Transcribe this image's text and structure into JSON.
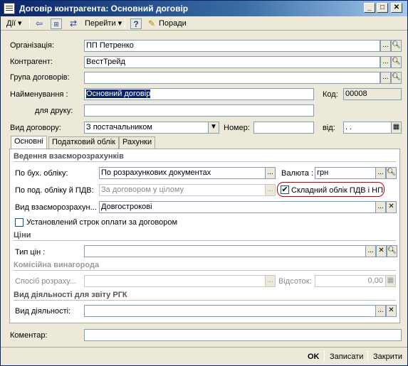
{
  "window": {
    "title": "Договір контрагента: Основний договір"
  },
  "menu": {
    "actions_label": "Дії",
    "goto_label": "Перейти",
    "help_icon_text": "?",
    "hints_label": "Поради"
  },
  "form": {
    "org_label": "Організація:",
    "org_value": "ПП Петренко",
    "counterparty_label": "Контрагент:",
    "counterparty_value": "ВестТрейд",
    "group_label": "Група договорів:",
    "group_value": "",
    "name_label": "Найменування :",
    "name_value": "Основний договір",
    "code_label": "Код:",
    "code_value": "00008",
    "print_label": "для друку:",
    "print_value": "",
    "type_label": "Вид договору:",
    "type_value": "З постачальником",
    "number_label": "Номер:",
    "number_value": "",
    "date_label": "від:",
    "date_value": " .  .",
    "comment_label": "Коментар:",
    "comment_value": ""
  },
  "tabs": [
    {
      "label": "Основні"
    },
    {
      "label": "Податковий облік"
    },
    {
      "label": "Рахунки"
    }
  ],
  "main_tab": {
    "settlements_section": "Ведення взаєморозрахунків",
    "acc_label": "По бух. обліку:",
    "acc_value": "По розрахункових документах",
    "currency_label": "Валюта :",
    "currency_value": "грн",
    "vat_label": "По под. обліку й ПДВ:",
    "vat_value": "За договором у цілому",
    "complex_vat_label": "Складний облік ПДВ і НП",
    "complex_vat_checked": "✔",
    "settle_type_label": "Вид взаєморозрахун...",
    "settle_type_value": "Довгострокові",
    "term_label": "Установлений строк оплати за договором",
    "prices_section": "Ціни",
    "price_type_label": "Тип цін :",
    "price_type_value": "",
    "commission_section": "Комісійна винагорода",
    "calc_method_label": "Спосіб розраху...",
    "calc_method_value": "",
    "percent_label": "Відсоток:",
    "percent_value": "0,00",
    "activity_section": "Вид діяльності для звіту РГК",
    "activity_label": "Вид діяльності:",
    "activity_value": ""
  },
  "buttons": {
    "ok": "OK",
    "save": "Записати",
    "close": "Закрити"
  }
}
